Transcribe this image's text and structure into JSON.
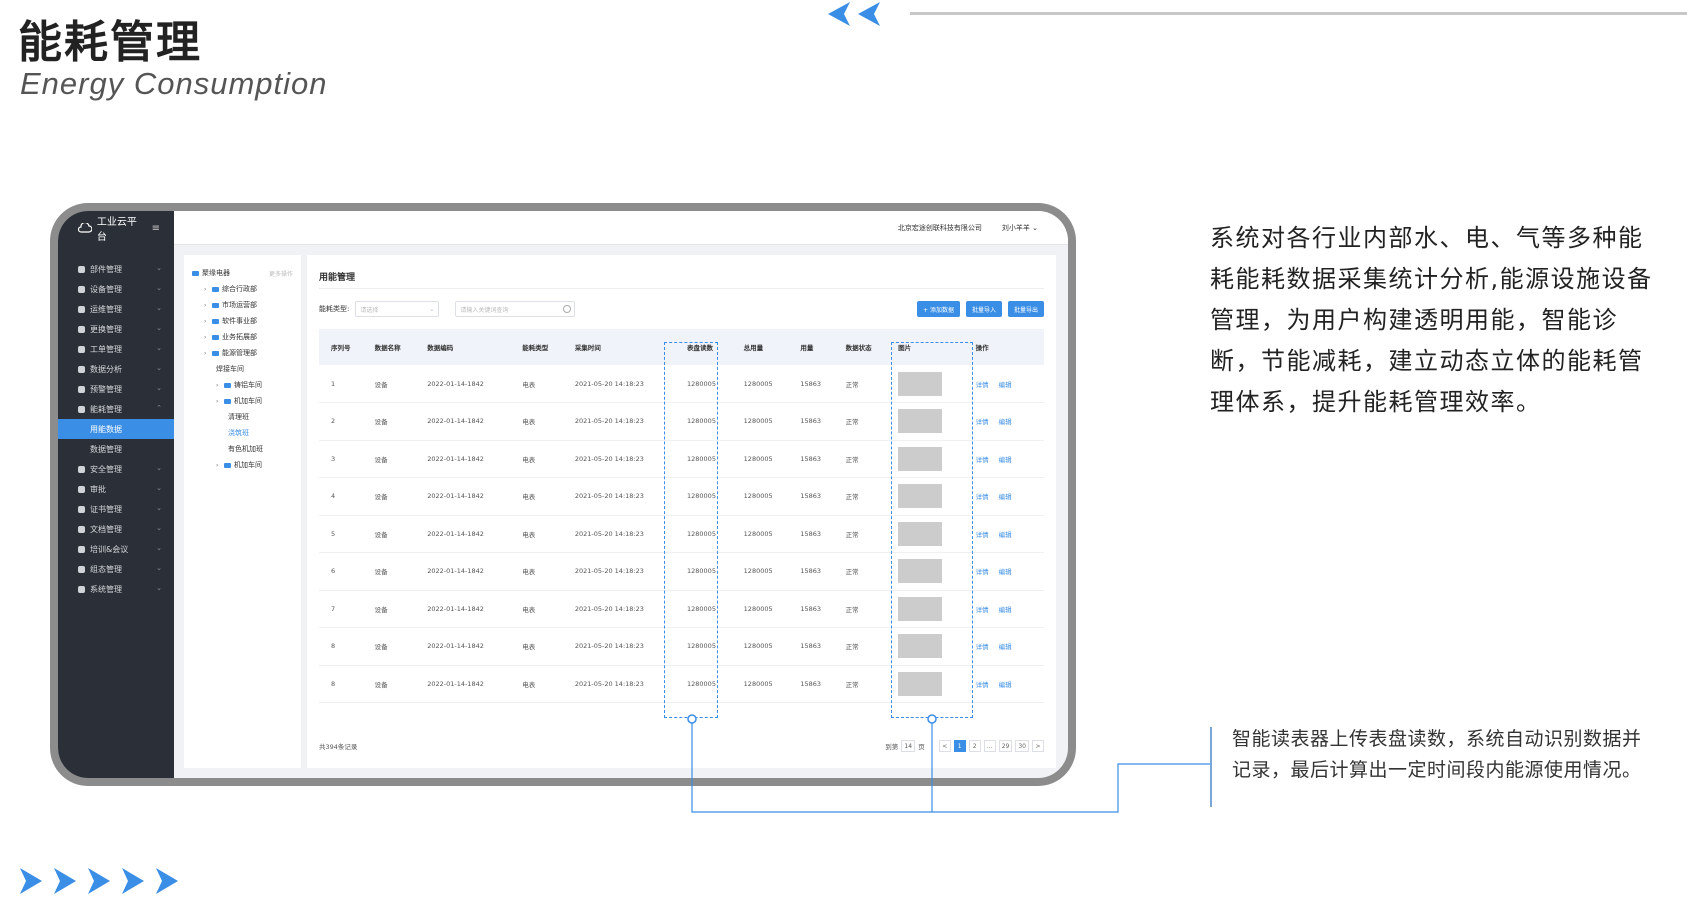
{
  "slide": {
    "title": "能耗管理",
    "subtitle": "Energy Consumption",
    "accent_color": "#3a8ee6"
  },
  "app": {
    "brand": "工业云平台",
    "company": "北京宏途创联科技有限公司",
    "user": "刘小羊羊",
    "sidebar": {
      "items": [
        {
          "label": "部件管理",
          "icon": "gear-icon"
        },
        {
          "label": "设备管理",
          "icon": "grid-icon"
        },
        {
          "label": "运维管理",
          "icon": "tools-icon"
        },
        {
          "label": "更换管理",
          "icon": "refresh-icon"
        },
        {
          "label": "工单管理",
          "icon": "list-icon"
        },
        {
          "label": "数据分析",
          "icon": "chart-icon"
        },
        {
          "label": "预警管理",
          "icon": "shield-icon"
        },
        {
          "label": "能耗管理",
          "icon": "energy-icon"
        }
      ],
      "sub_items": [
        {
          "label": "用能数据",
          "active": true
        },
        {
          "label": "数据管理",
          "active": false
        }
      ],
      "items_after": [
        {
          "label": "安全管理",
          "icon": "lock-icon"
        },
        {
          "label": "审批",
          "icon": "user-icon"
        },
        {
          "label": "证书管理",
          "icon": "certificate-icon"
        },
        {
          "label": "文档管理",
          "icon": "document-icon"
        },
        {
          "label": "培训&会议",
          "icon": "meeting-icon"
        },
        {
          "label": "组态管理",
          "icon": "config-icon"
        },
        {
          "label": "系统管理",
          "icon": "settings-icon"
        }
      ]
    },
    "tree": {
      "root": "聚缘电器",
      "root_hint": "更多操作",
      "nodes": [
        {
          "label": "综合行政部",
          "level": 1
        },
        {
          "label": "市场运营部",
          "level": 1
        },
        {
          "label": "软件事业部",
          "level": 1
        },
        {
          "label": "业务拓展部",
          "level": 1
        },
        {
          "label": "能源管理部",
          "level": 1
        },
        {
          "label": "焊接车间",
          "level": 2
        },
        {
          "label": "铸铝车间",
          "level": 2
        },
        {
          "label": "机加车间",
          "level": 2
        },
        {
          "label": "清理班",
          "level": 3
        },
        {
          "label": "浇筑班",
          "level": 3,
          "selected": true
        },
        {
          "label": "有色机加班",
          "level": 3
        },
        {
          "label": "机加车间",
          "level": 2
        }
      ]
    },
    "panel_title": "用能管理",
    "filters": {
      "type_label": "能耗类型:",
      "type_placeholder": "请选择",
      "search_placeholder": "请输入关键词查询"
    },
    "buttons": {
      "add": "+ 添加数据",
      "batch_import": "批量导入",
      "batch_export": "批量导出"
    },
    "table": {
      "columns": [
        "序列号",
        "数据名称",
        "数据编码",
        "能耗类型",
        "采集时间",
        "表盘读数",
        "总用量",
        "用量",
        "数据状态",
        "图片",
        "操作"
      ],
      "rows": [
        [
          "1",
          "设备",
          "2022-01-14-1842",
          "电表",
          "2021-05-20 14:18:23",
          "1280005",
          "1280005",
          "15863",
          "正常"
        ],
        [
          "2",
          "设备",
          "2022-01-14-1842",
          "电表",
          "2021-05-20 14:18:23",
          "1280005",
          "1280005",
          "15863",
          "正常"
        ],
        [
          "3",
          "设备",
          "2022-01-14-1842",
          "电表",
          "2021-05-20 14:18:23",
          "1280005",
          "1280005",
          "15863",
          "正常"
        ],
        [
          "4",
          "设备",
          "2022-01-14-1842",
          "电表",
          "2021-05-20 14:18:23",
          "1280005",
          "1280005",
          "15863",
          "正常"
        ],
        [
          "5",
          "设备",
          "2022-01-14-1842",
          "电表",
          "2021-05-20 14:18:23",
          "1280005",
          "1280005",
          "15863",
          "正常"
        ],
        [
          "6",
          "设备",
          "2022-01-14-1842",
          "电表",
          "2021-05-20 14:18:23",
          "1280005",
          "1280005",
          "15863",
          "正常"
        ],
        [
          "7",
          "设备",
          "2022-01-14-1842",
          "电表",
          "2021-05-20 14:18:23",
          "1280005",
          "1280005",
          "15863",
          "正常"
        ],
        [
          "8",
          "设备",
          "2022-01-14-1842",
          "电表",
          "2021-05-20 14:18:23",
          "1280005",
          "1280005",
          "15863",
          "正常"
        ],
        [
          "8",
          "设备",
          "2022-01-14-1842",
          "电表",
          "2021-05-20 14:18:23",
          "1280005",
          "1280005",
          "15863",
          "正常"
        ]
      ],
      "op_detail": "详情",
      "op_edit": "编辑"
    },
    "footer": {
      "total": "共394条记录",
      "jump_label": "到第",
      "jump_value": "14",
      "jump_unit": "页",
      "pages": [
        "<",
        "1",
        "2",
        "...",
        "29",
        "30",
        ">"
      ],
      "active_page": "1"
    }
  },
  "description": {
    "main": "系统对各行业内部水、电、气等多种能耗能耗数据采集统计分析,能源设施设备管理，为用户构建透明用能，智能诊断，节能减耗，建立动态立体的能耗管理体系，提升能耗管理效率。",
    "note": "智能读表器上传表盘读数，系统自动识别数据并记录，最后计算出一定时间段内能源使用情况。"
  }
}
